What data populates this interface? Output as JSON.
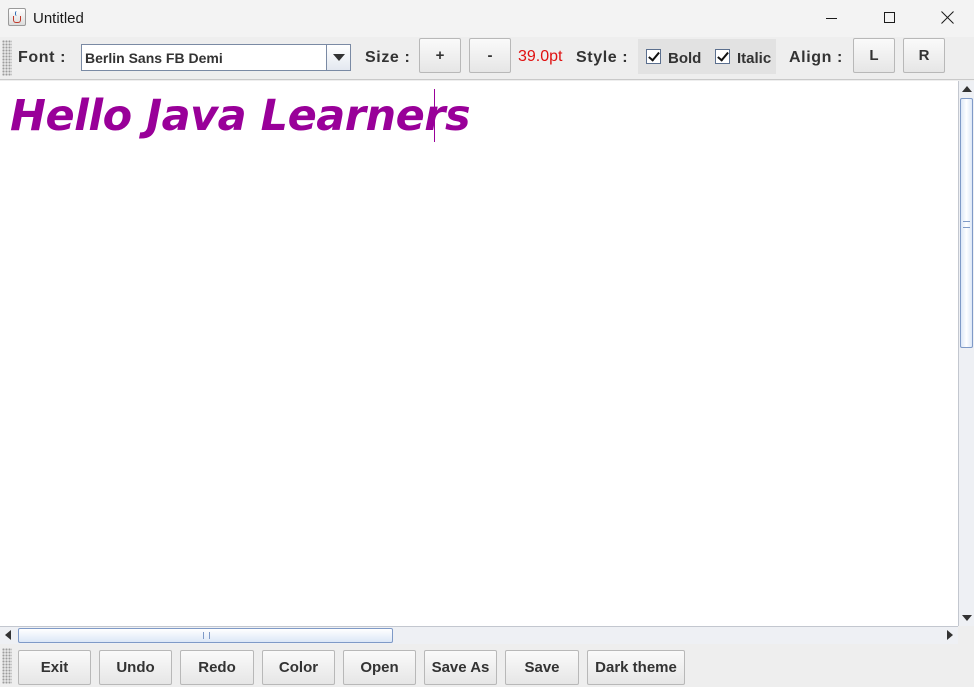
{
  "window": {
    "title": "Untitled"
  },
  "toolbar": {
    "font_label": "Font :",
    "font_value": "Berlin Sans FB Demi",
    "size_label": "Size :",
    "size_increase": "+",
    "size_decrease": "-",
    "size_value": "39.0pt",
    "style_label": "Style :",
    "bold_label": "Bold",
    "bold_checked": true,
    "italic_label": "Italic",
    "italic_checked": true,
    "align_label": "Align :",
    "align_left": "L",
    "align_right": "R"
  },
  "editor": {
    "text": "Hello Java Learners",
    "text_color": "#990099"
  },
  "bottom": {
    "buttons": [
      "Exit",
      "Undo",
      "Redo",
      "Color",
      "Open",
      "Save As",
      "Save",
      "Dark theme"
    ]
  },
  "colors": {
    "size_value": "#e01010",
    "editor_text": "#990099"
  },
  "icons": {
    "app": "java-cup-icon",
    "minimize": "minimize-icon",
    "maximize": "maximize-icon",
    "close": "close-icon"
  }
}
